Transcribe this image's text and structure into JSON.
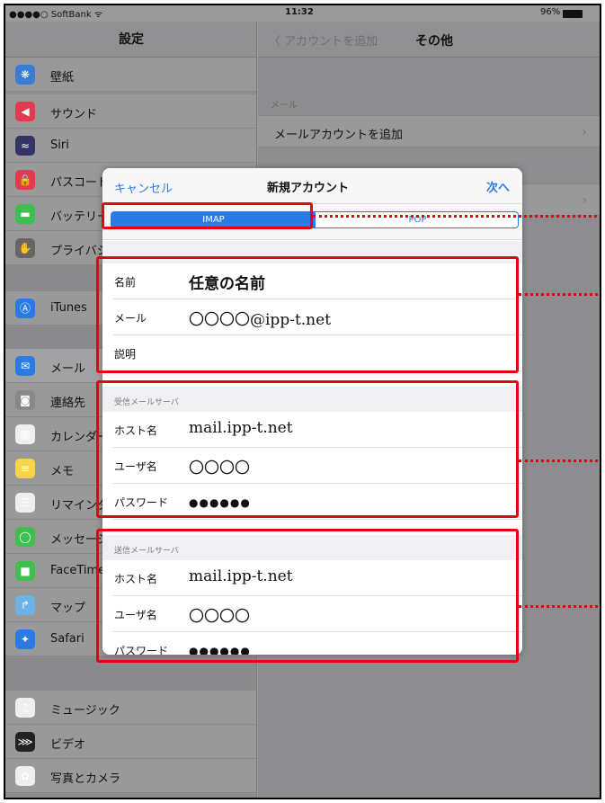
{
  "status_bar": {
    "carrier": "●●●●○ SoftBank ᯤ",
    "time": "11:32",
    "battery": "96%"
  },
  "sidebar": {
    "title": "設定",
    "items": [
      {
        "label": "壁紙",
        "icon": "wallpaper-icon",
        "color": "#3a7bd5",
        "glyph": "❋"
      },
      {
        "label": "サウンド",
        "icon": "sound-icon",
        "color": "#e33a4f",
        "glyph": "◀"
      },
      {
        "label": "Siri",
        "icon": "siri-icon",
        "color": "#333366",
        "glyph": "≈"
      },
      {
        "label": "パスコード",
        "icon": "passcode-icon",
        "color": "#e33a4f",
        "glyph": "🔒"
      },
      {
        "label": "バッテリー",
        "icon": "battery-icon",
        "color": "#3fbf4f",
        "glyph": "▬"
      },
      {
        "label": "プライバシー",
        "icon": "privacy-icon",
        "color": "#666",
        "glyph": "✋"
      },
      {
        "label": "iTunes",
        "icon": "appstore-icon",
        "color": "#2a7be5",
        "glyph": "Ⓐ"
      },
      {
        "label": "メール",
        "icon": "mail-icon",
        "color": "#2a7be5",
        "glyph": "✉"
      },
      {
        "label": "連絡先",
        "icon": "contacts-icon",
        "color": "#888",
        "glyph": "◙"
      },
      {
        "label": "カレンダー",
        "icon": "calendar-icon",
        "color": "#eee",
        "glyph": "▦"
      },
      {
        "label": "メモ",
        "icon": "notes-icon",
        "color": "#f5d547",
        "glyph": "≡"
      },
      {
        "label": "リマインダー",
        "icon": "reminders-icon",
        "color": "#eee",
        "glyph": "☰"
      },
      {
        "label": "メッセージ",
        "icon": "messages-icon",
        "color": "#3fbf4f",
        "glyph": "◯"
      },
      {
        "label": "FaceTime",
        "icon": "facetime-icon",
        "color": "#3fbf4f",
        "glyph": "■"
      },
      {
        "label": "マップ",
        "icon": "maps-icon",
        "color": "#6cb4e8",
        "glyph": "↱"
      },
      {
        "label": "Safari",
        "icon": "safari-icon",
        "color": "#2a7be5",
        "glyph": "✦"
      },
      {
        "label": "ミュージック",
        "icon": "music-icon",
        "color": "#eee",
        "glyph": "♫"
      },
      {
        "label": "ビデオ",
        "icon": "videos-icon",
        "color": "#222",
        "glyph": "⋙"
      },
      {
        "label": "写真とカメラ",
        "icon": "photos-icon",
        "color": "#eee",
        "glyph": "✿"
      }
    ]
  },
  "detail": {
    "back_label": "〈 アカウントを追加",
    "title": "その他",
    "section_header": "メール",
    "row_label": "メールアカウントを追加"
  },
  "modal": {
    "cancel": "キャンセル",
    "title": "新規アカウント",
    "next": "次へ",
    "segments": [
      "IMAP",
      "POP"
    ],
    "selected_segment": "IMAP",
    "account": {
      "name_label": "名前",
      "name_value": "任意の名前",
      "email_label": "メール",
      "email_value": "〇〇〇〇@ipp-t.net",
      "desc_label": "説明",
      "desc_value": ""
    },
    "incoming": {
      "header": "受信メールサーバ",
      "host_label": "ホスト名",
      "host_value": "mail.ipp-t.net",
      "user_label": "ユーザ名",
      "user_value": "〇〇〇〇",
      "pass_label": "パスワード",
      "pass_value": "●●●●●●"
    },
    "outgoing": {
      "header": "送信メールサーバ",
      "host_label": "ホスト名",
      "host_value": "mail.ipp-t.net",
      "user_label": "ユーザ名",
      "user_value": "〇〇〇〇",
      "pass_label": "パスワード",
      "pass_value": "●●●●●●"
    }
  },
  "annotation_color": "#e60012",
  "accent_color": "#2a7be5"
}
